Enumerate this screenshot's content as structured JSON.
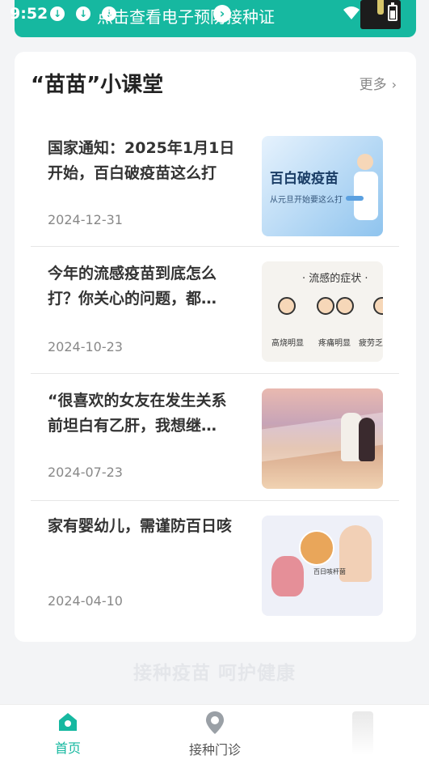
{
  "status_bar": {
    "time": "9:52"
  },
  "banner": {
    "text": "点击查看电子预防接种证"
  },
  "section": {
    "title": "“苗苗”小课堂",
    "more_label": "更多"
  },
  "articles": [
    {
      "title": "国家通知：2025年1月1日开始，百白破疫苗这么打",
      "date": "2024-12-31",
      "thumb_title": "百白破疫苗",
      "thumb_subtitle": "从元旦开始要这么打"
    },
    {
      "title": "今年的流感疫苗到底怎么打？你关心的问题，都…",
      "date": "2024-10-23",
      "thumb_title": "· 流感的症状 ·",
      "thumb_labels": [
        "高烧明显",
        "疼痛明显",
        "疲劳乏"
      ]
    },
    {
      "title": "“很喜欢的女友在发生关系前坦白有乙肝，我想继…",
      "date": "2024-07-23"
    },
    {
      "title": "家有婴幼儿，需谨防百日咳",
      "date": "2024-04-10",
      "thumb_label": "百日咳杆菌"
    }
  ],
  "slogan": "接种疫苗  呵护健康",
  "bottom_nav": {
    "home_label": "首页",
    "clinic_label": "接种门诊"
  },
  "colors": {
    "accent": "#16b8a0",
    "background": "#f3f4f6"
  }
}
